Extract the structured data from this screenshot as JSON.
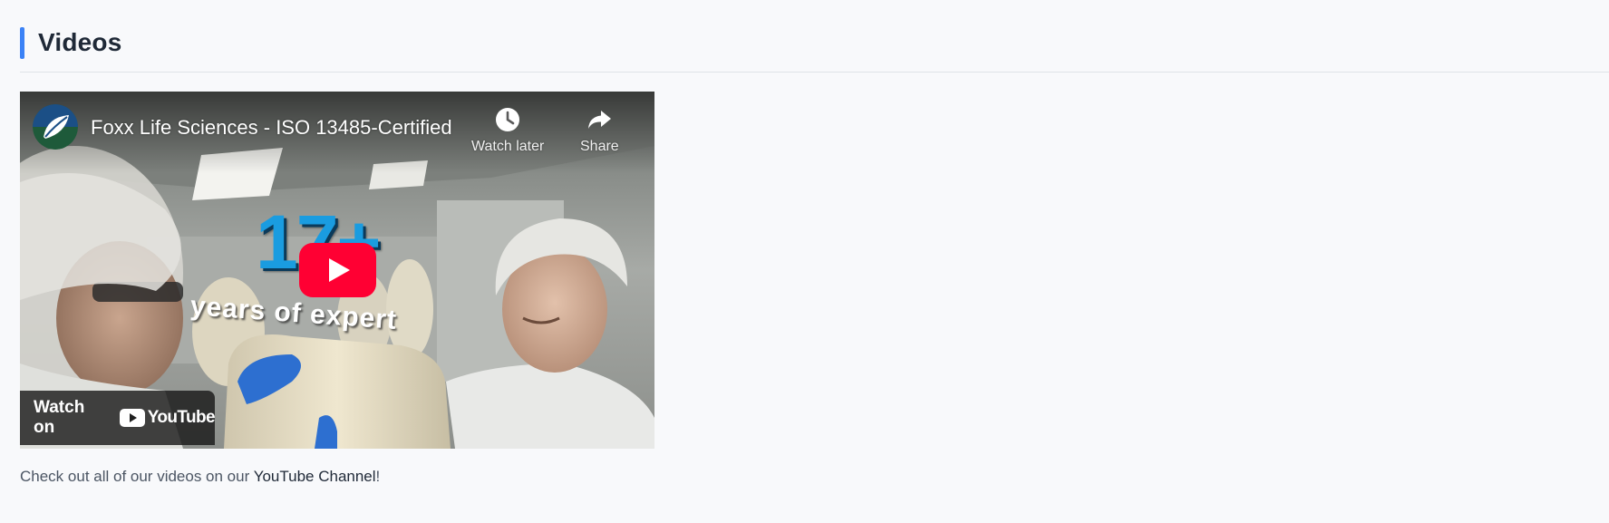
{
  "section": {
    "title": "Videos"
  },
  "video": {
    "title": "Foxx Life Sciences - ISO 13485-Certified",
    "overlay_number": "17+",
    "overlay_text": "years of expert",
    "actions": {
      "watch_later": "Watch later",
      "share": "Share"
    },
    "watch_on": {
      "text": "Watch on",
      "brand": "YouTube"
    }
  },
  "caption": {
    "prefix": "Check out all of our videos on our ",
    "link": "YouTube Channel",
    "suffix": "!"
  },
  "colors": {
    "accent": "#3b82f6",
    "youtube_red": "#ff0033",
    "title_text": "#1f2937"
  },
  "icons": {
    "watch_later": "clock-icon",
    "share": "share-arrow-icon",
    "play": "play-icon",
    "avatar": "leaf-logo-icon"
  }
}
